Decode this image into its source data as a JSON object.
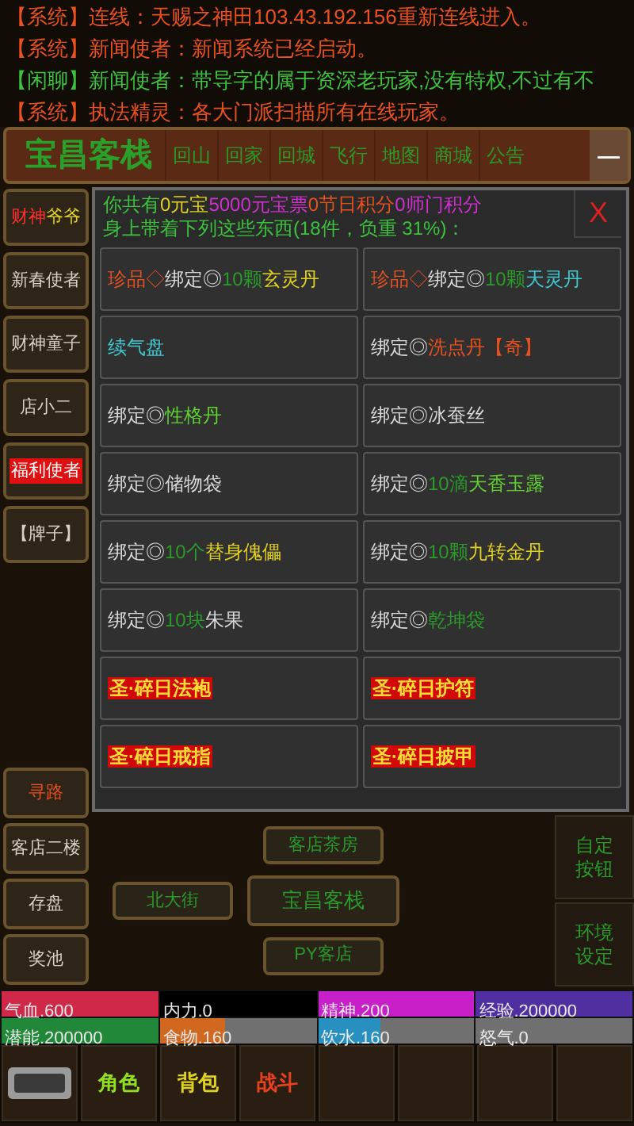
{
  "chat": [
    {
      "channel": "【系统】",
      "text": "连线：天赐之神田103.43.192.156重新连线进入。",
      "color": "#e8501e"
    },
    {
      "channel": "【系统】",
      "text": "新闻使者：新闻系统已经启动。",
      "color": "#e8501e"
    },
    {
      "channel": "【闲聊】",
      "text": "新闻使者：带导字的属于资深老玩家,没有特权,不过有不",
      "color": "#3cc23c"
    },
    {
      "channel": "【系统】",
      "text": "执法精灵：各大门派扫描所有在线玩家。",
      "color": "#e8501e"
    }
  ],
  "nav": {
    "location": "宝昌客栈",
    "buttons": [
      "回山",
      "回家",
      "回城",
      "飞行",
      "地图",
      "商城",
      "公告"
    ],
    "collapse": "—"
  },
  "left_buttons_top": [
    {
      "segments": [
        {
          "text": "财神",
          "color": "#ff3030"
        },
        {
          "text": "爷爷",
          "color": "#e0d020"
        }
      ],
      "highlighted": false
    },
    {
      "segments": [
        {
          "text": "新春使者",
          "color": "#d8d0c0"
        }
      ],
      "highlighted": false
    },
    {
      "segments": [
        {
          "text": "财神童子",
          "color": "#d8d0c0"
        }
      ],
      "highlighted": false
    },
    {
      "segments": [
        {
          "text": "店小二",
          "color": "#d8d0c0"
        }
      ],
      "highlighted": false
    },
    {
      "segments": [
        {
          "text": "福利使者",
          "color": "#ffffff"
        }
      ],
      "highlighted": true
    },
    {
      "segments": [
        {
          "text": "【牌子】",
          "color": "#d8d0c0"
        }
      ],
      "highlighted": false
    }
  ],
  "left_buttons_bottom": [
    {
      "label": "寻路",
      "color": "#e8501e"
    },
    {
      "label": "客店二楼",
      "color": "#d8d0c0"
    },
    {
      "label": "存盘",
      "color": "#d8d0c0"
    },
    {
      "label": "奖池",
      "color": "#d8d0c0"
    }
  ],
  "inventory": {
    "summary": [
      {
        "text": "你共有",
        "color": "#3cc23c"
      },
      {
        "text": "0元宝",
        "color": "#e0d020"
      },
      {
        "text": "5000元宝票",
        "color": "#d030d0"
      },
      {
        "text": "0节日积分",
        "color": "#e8501e"
      },
      {
        "text": "0师门积分",
        "color": "#d030d0"
      }
    ],
    "load": "身上带着下列这些东西(18件，负重 31%)：",
    "close": "X",
    "items": [
      {
        "kind": "normal",
        "segments": [
          {
            "text": "珍品◇",
            "color": "#e8501e"
          },
          {
            "text": "绑定◎",
            "color": "#d8d8d8"
          },
          {
            "text": "10颗",
            "color": "#2a9a2a"
          },
          {
            "text": "玄灵丹",
            "color": "#e0d020"
          }
        ]
      },
      {
        "kind": "normal",
        "segments": [
          {
            "text": "珍品◇",
            "color": "#e8501e"
          },
          {
            "text": "绑定◎",
            "color": "#d8d8d8"
          },
          {
            "text": "10颗",
            "color": "#2a9a2a"
          },
          {
            "text": "天灵丹",
            "color": "#40c8d0"
          }
        ]
      },
      {
        "kind": "normal",
        "segments": [
          {
            "text": "续气盘",
            "color": "#40c8d0"
          }
        ]
      },
      {
        "kind": "normal",
        "segments": [
          {
            "text": "绑定◎",
            "color": "#d8d8d8"
          },
          {
            "text": "洗点丹【奇】",
            "color": "#e8501e"
          }
        ]
      },
      {
        "kind": "normal",
        "segments": [
          {
            "text": "绑定◎",
            "color": "#d8d8d8"
          },
          {
            "text": "性格丹",
            "color": "#60d030"
          }
        ]
      },
      {
        "kind": "normal",
        "segments": [
          {
            "text": "绑定◎冰蚕丝",
            "color": "#d8d8d8"
          }
        ]
      },
      {
        "kind": "normal",
        "segments": [
          {
            "text": "绑定◎储物袋",
            "color": "#d8d8d8"
          }
        ]
      },
      {
        "kind": "normal",
        "segments": [
          {
            "text": "绑定◎",
            "color": "#d8d8d8"
          },
          {
            "text": "10滴",
            "color": "#2a9a2a"
          },
          {
            "text": "天香玉露",
            "color": "#60d030"
          }
        ]
      },
      {
        "kind": "normal",
        "segments": [
          {
            "text": "绑定◎",
            "color": "#d8d8d8"
          },
          {
            "text": "10个",
            "color": "#2a9a2a"
          },
          {
            "text": "替身傀儡",
            "color": "#e0d020"
          }
        ]
      },
      {
        "kind": "normal",
        "segments": [
          {
            "text": "绑定◎",
            "color": "#d8d8d8"
          },
          {
            "text": "10颗",
            "color": "#2a9a2a"
          },
          {
            "text": "九转金丹",
            "color": "#e0d020"
          }
        ]
      },
      {
        "kind": "normal",
        "segments": [
          {
            "text": "绑定◎",
            "color": "#d8d8d8"
          },
          {
            "text": "10块",
            "color": "#2a9a2a"
          },
          {
            "text": "朱果",
            "color": "#d8d8d8"
          }
        ]
      },
      {
        "kind": "normal",
        "segments": [
          {
            "text": "绑定◎",
            "color": "#d8d8d8"
          },
          {
            "text": "乾坤袋",
            "color": "#2a9a2a"
          }
        ]
      },
      {
        "kind": "highlight",
        "segments": [
          {
            "text": "圣·碎日法袍"
          }
        ]
      },
      {
        "kind": "highlight",
        "segments": [
          {
            "text": "圣·碎日护符"
          }
        ]
      },
      {
        "kind": "highlight",
        "segments": [
          {
            "text": "圣·碎日戒指"
          }
        ]
      },
      {
        "kind": "highlight",
        "segments": [
          {
            "text": "圣·碎日披甲"
          }
        ]
      }
    ]
  },
  "map": {
    "north": "客店茶房",
    "west": "北大街",
    "center": "宝昌客栈",
    "south": "PY客店"
  },
  "side_buttons": [
    {
      "lines": [
        "自定",
        "按钮"
      ]
    },
    {
      "lines": [
        "环境",
        "设定"
      ]
    }
  ],
  "stats": [
    {
      "label": "气血.600",
      "level": 1,
      "color": "#d02848"
    },
    {
      "label": "内力.0",
      "level": 1,
      "color": "#000000"
    },
    {
      "label": "精神.200",
      "level": 1,
      "color": "#c820c8"
    },
    {
      "label": "经验.200000",
      "level": 1,
      "color": "#5030a0"
    },
    {
      "label": "潜能.200000",
      "level": 1,
      "color": "#208838"
    },
    {
      "label": "食物.160",
      "level": 0.42,
      "color": "#d06820"
    },
    {
      "label": "饮水.160",
      "level": 0.4,
      "color": "#2890c0"
    },
    {
      "label": "怒气.0"
    }
  ],
  "toolbar": [
    {
      "kind": "icon"
    },
    {
      "kind": "text",
      "label": "角色",
      "color": "#90e020"
    },
    {
      "kind": "text",
      "label": "背包",
      "color": "#e0d020"
    },
    {
      "kind": "text",
      "label": "战斗",
      "color": "#e8401e"
    }
  ]
}
